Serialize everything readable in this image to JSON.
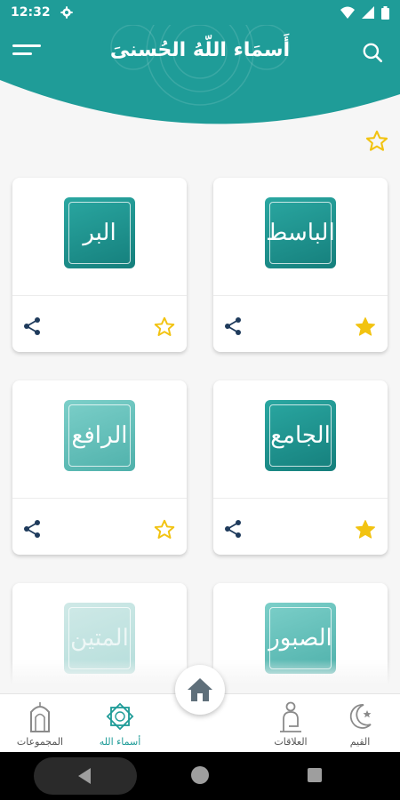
{
  "status_bar": {
    "time": "12:32"
  },
  "header": {
    "title": "أَسمَاء اللّهُ الحُسنىَ"
  },
  "cards": [
    {
      "name": "البر",
      "favorite": false,
      "style": "dark"
    },
    {
      "name": "الباسط",
      "favorite": true,
      "style": "dark"
    },
    {
      "name": "الرافع",
      "favorite": false,
      "style": "light"
    },
    {
      "name": "الجامع",
      "favorite": true,
      "style": "dark"
    },
    {
      "name": "المتين",
      "favorite": false,
      "style": "faded"
    },
    {
      "name": "الصبور",
      "favorite": false,
      "style": "light"
    }
  ],
  "bottom_nav": {
    "items": [
      {
        "label": "المجموعات",
        "icon": "mosque-door-icon",
        "active": false
      },
      {
        "label": "أسماء الله",
        "icon": "star-octagon-icon",
        "active": true
      },
      {
        "label": "العلاقات",
        "icon": "praying-person-icon",
        "active": false
      },
      {
        "label": "القيم",
        "icon": "crescent-star-icon",
        "active": false
      }
    ]
  },
  "colors": {
    "primary": "#1f9c98",
    "star": "#f2c311"
  }
}
